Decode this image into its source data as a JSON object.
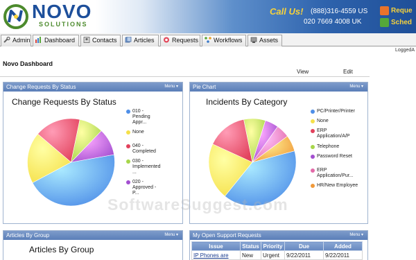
{
  "header": {
    "logo_text": "NOVO",
    "logo_sub": "SOLUTIONS",
    "call_us": "Call Us!",
    "phone_us": "(888)316-4559 US",
    "phone_uk": "020 7669 4008 UK",
    "request_label": "Reque",
    "schedule_label": "Sched"
  },
  "tabs": [
    "Admin",
    "Dashboard",
    "Contacts",
    "Articles",
    "Requests",
    "Workflows",
    "Assets"
  ],
  "logged_in": "LoggedA",
  "page_title": "Novo Dashboard",
  "view_link": "View",
  "edit_link": "Edit",
  "watermark": "SoftwareSuggest.com",
  "panels": {
    "change": {
      "header": "Change Requests By Status",
      "menu": "Menu ▾",
      "title": "Change Requests By Status"
    },
    "pie": {
      "header": "Pie Chart",
      "menu": "Menu ▾",
      "title": "Incidents By Category"
    },
    "articles": {
      "header": "Articles By Group",
      "menu": "Menu ▾",
      "title": "Articles By Group"
    },
    "support": {
      "header": "My Open Support Requests",
      "menu": "Menu ▾"
    }
  },
  "support_table": {
    "columns": [
      "Issue",
      "Status",
      "Priority",
      "Due",
      "Added"
    ],
    "rows": [
      [
        "IP Phones are",
        "New",
        "Urgent",
        "9/22/2011",
        "9/22/2011"
      ]
    ]
  },
  "colors": {
    "blue": "#4f8fe8",
    "yellow": "#f5e04a",
    "red": "#e2425c",
    "green": "#a7d64a",
    "purple": "#a34fd0",
    "pink": "#e36ba9",
    "orange": "#f0993a",
    "light_purple": "#c9a3f0"
  },
  "chart_data": [
    {
      "type": "pie",
      "title": "Change Requests By Status",
      "labels": [
        "010 - Pending Appr...",
        "None",
        "040 - Completed",
        "030 - Implemented ...",
        "020 - Approved - P..."
      ],
      "values": [
        45,
        19,
        17,
        9,
        10
      ],
      "colors": [
        "#4f8fe8",
        "#f5e04a",
        "#e2425c",
        "#a7d64a",
        "#a34fd0"
      ]
    },
    {
      "type": "pie",
      "title": "Incidents By Category",
      "labels": [
        "PC/Printer/Printer",
        "None",
        "ERP Application/A/P",
        "Telephone",
        "Password Reset",
        "ERP Application/Pur...",
        "HR/New Employee"
      ],
      "values": [
        40,
        21,
        15,
        8,
        5,
        5,
        6
      ],
      "colors": [
        "#4f8fe8",
        "#f5e04a",
        "#e2425c",
        "#a7d64a",
        "#a34fd0",
        "#e36ba9",
        "#f0993a"
      ]
    }
  ]
}
